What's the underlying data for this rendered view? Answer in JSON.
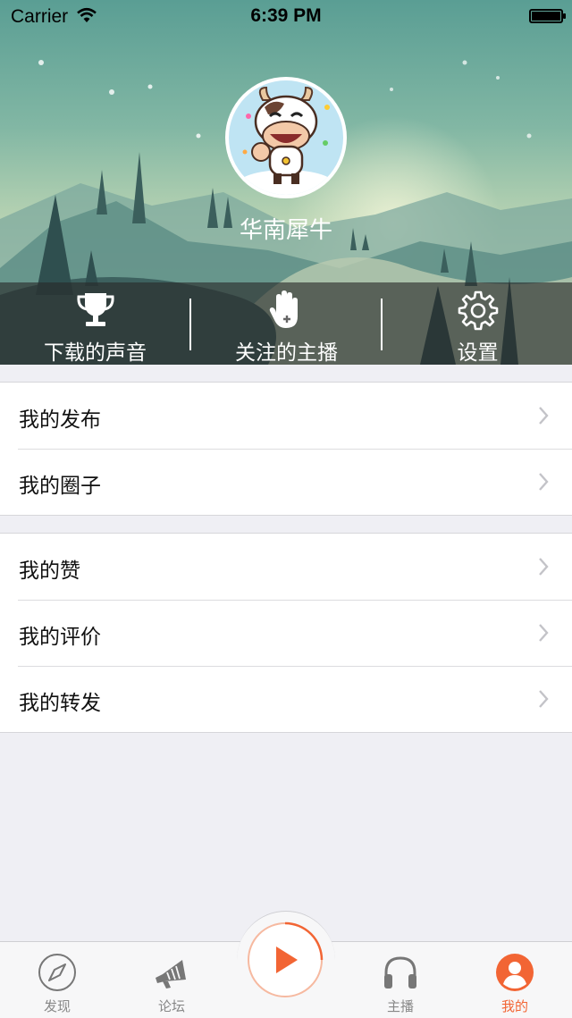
{
  "status_bar": {
    "carrier": "Carrier",
    "time": "6:39 PM"
  },
  "profile": {
    "username": "华南犀牛"
  },
  "actions": [
    {
      "label": "下载的声音",
      "icon": "trophy-icon"
    },
    {
      "label": "关注的主播",
      "icon": "hand-icon"
    },
    {
      "label": "设置",
      "icon": "gear-icon"
    }
  ],
  "menu_group_1": [
    {
      "label": "我的发布"
    },
    {
      "label": "我的圈子"
    }
  ],
  "menu_group_2": [
    {
      "label": "我的赞"
    },
    {
      "label": "我的评价"
    },
    {
      "label": "我的转发"
    }
  ],
  "tabbar": {
    "tabs": [
      {
        "label": "发现",
        "icon": "compass-icon"
      },
      {
        "label": "论坛",
        "icon": "megaphone-icon"
      },
      {
        "label": "主播",
        "icon": "headphones-icon"
      },
      {
        "label": "我的",
        "icon": "user-icon"
      }
    ],
    "active": "我的",
    "play_icon": "play-icon"
  },
  "colors": {
    "accent": "#f26534",
    "background": "#efeff4"
  }
}
